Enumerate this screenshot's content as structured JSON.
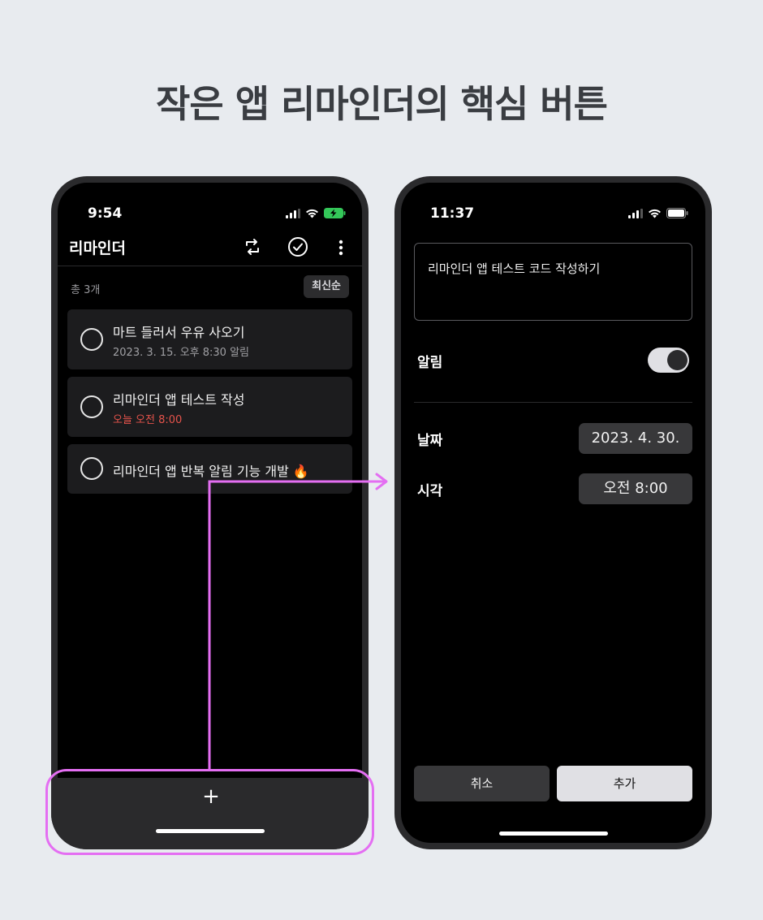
{
  "headline": "작은 앱 리마인더의 핵심 버튼",
  "colors": {
    "background": "#e8ebef",
    "phone_frame": "#2a2a2c",
    "screen": "#000000",
    "card": "#1c1c1e",
    "highlight": "#e46ef2",
    "due_today": "#e5534b",
    "battery_charging": "#34c759"
  },
  "list_screen": {
    "status_time": "9:54",
    "battery_state": "charging",
    "title": "리마인더",
    "header_icons": [
      "sync-icon",
      "check-circle-icon",
      "more-vertical-icon"
    ],
    "count_text": "총 3개",
    "sort_label": "최신순",
    "reminders": [
      {
        "title": "마트 들러서 우유 사오기",
        "subtitle": "2023. 3. 15. 오후 8:30 알림",
        "subtitle_style": "normal"
      },
      {
        "title": "리마인더 앱 테스트 작성",
        "subtitle": "오늘 오전 8:00",
        "subtitle_style": "due-today"
      },
      {
        "title": "리마인더 앱 반복 알림 기능 개발 🔥",
        "subtitle": "",
        "subtitle_style": "none"
      }
    ],
    "add_button_label": "+"
  },
  "add_screen": {
    "status_time": "11:37",
    "memo_text": "리마인더 앱 테스트 코드 작성하기",
    "alarm_label": "알림",
    "alarm_enabled": true,
    "date_label": "날짜",
    "date_value": "2023. 4. 30.",
    "time_label": "시각",
    "time_value": "오전 8:00",
    "cancel_label": "취소",
    "add_label": "추가"
  }
}
